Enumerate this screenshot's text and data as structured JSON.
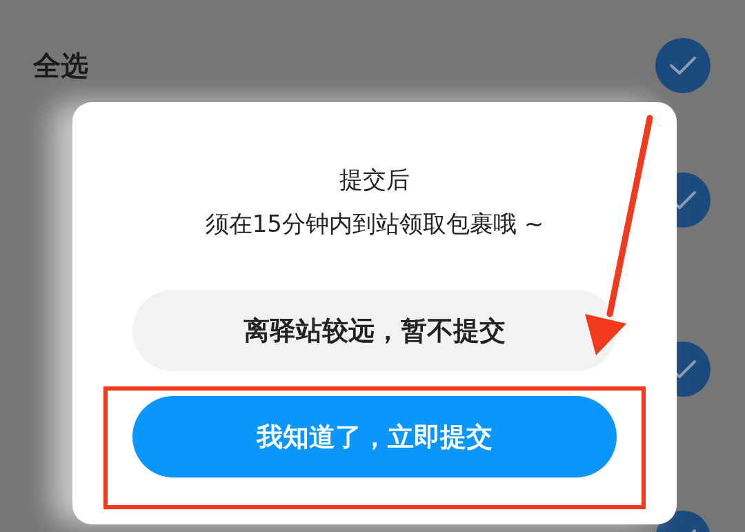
{
  "select_all": {
    "label": "全选",
    "checked": true
  },
  "items": [
    {
      "checked": true
    },
    {
      "checked": true
    },
    {
      "checked": true
    }
  ],
  "dialog": {
    "message": [
      "提交后",
      "须在15分钟内到站领取包裹哦 ~"
    ],
    "buttons": [
      {
        "label": "离驿站较远，暂不提交",
        "kind": "secondary",
        "highlighted": false
      },
      {
        "label": "我知道了，立即提交",
        "kind": "primary",
        "highlighted": true
      }
    ]
  }
}
